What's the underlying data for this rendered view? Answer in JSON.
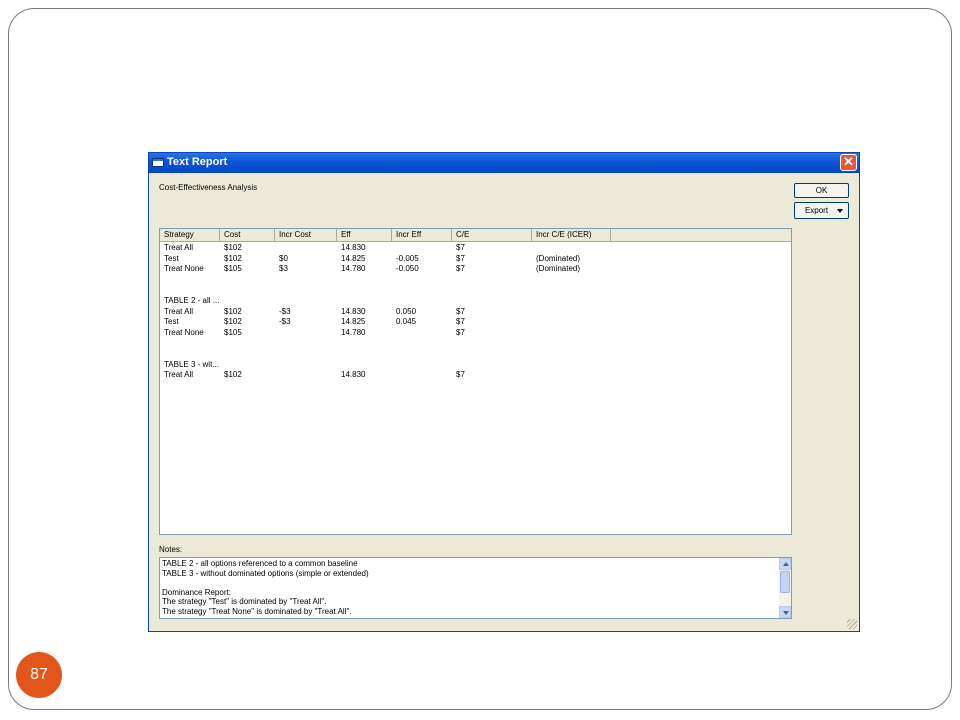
{
  "slide": {
    "page_number": "87",
    "accent_color": "#e2561b"
  },
  "window": {
    "title": "Text Report",
    "close_glyph": "✕",
    "heading": "Cost-Effectiveness Analysis",
    "buttons": {
      "ok": "OK",
      "export": "Export"
    }
  },
  "table": {
    "columns": [
      "Strategy",
      "Cost",
      "Incr Cost",
      "Eff",
      "Incr Eff",
      "C/E",
      "Incr C/E (ICER)"
    ],
    "rows": [
      [
        "Treat All",
        "$102",
        "",
        "14.830",
        "",
        "$7",
        ""
      ],
      [
        "Test",
        "$102",
        "$0",
        "14.825",
        "-0.005",
        "$7",
        "(Dominated)"
      ],
      [
        "Treat None",
        "$105",
        "$3",
        "14.780",
        "-0.050",
        "$7",
        "(Dominated)"
      ],
      [
        "",
        "",
        "",
        "",
        "",
        "",
        ""
      ],
      [
        "",
        "",
        "",
        "",
        "",
        "",
        ""
      ],
      [
        "TABLE 2 - all ...",
        "",
        "",
        "",
        "",
        "",
        ""
      ],
      [
        "Treat All",
        "$102",
        "-$3",
        "14.830",
        "0.050",
        "$7",
        ""
      ],
      [
        "Test",
        "$102",
        "-$3",
        "14.825",
        "0.045",
        "$7",
        ""
      ],
      [
        "Treat None",
        "$105",
        "",
        "14.780",
        "",
        "$7",
        ""
      ],
      [
        "",
        "",
        "",
        "",
        "",
        "",
        ""
      ],
      [
        "",
        "",
        "",
        "",
        "",
        "",
        ""
      ],
      [
        "TABLE 3 - wit...",
        "",
        "",
        "",
        "",
        "",
        ""
      ],
      [
        "Treat All",
        "$102",
        "",
        "14.830",
        "",
        "$7",
        ""
      ]
    ]
  },
  "notes": {
    "label": "Notes:",
    "lines": [
      "TABLE 2 - all options referenced to a common baseline",
      "TABLE 3 - without dominated options (simple or extended)",
      "",
      "Dominance Report:",
      "The strategy \"Test\" is dominated by \"Treat All\".",
      "The strategy \"Treat None\" is dominated by \"Treat All\"."
    ]
  }
}
